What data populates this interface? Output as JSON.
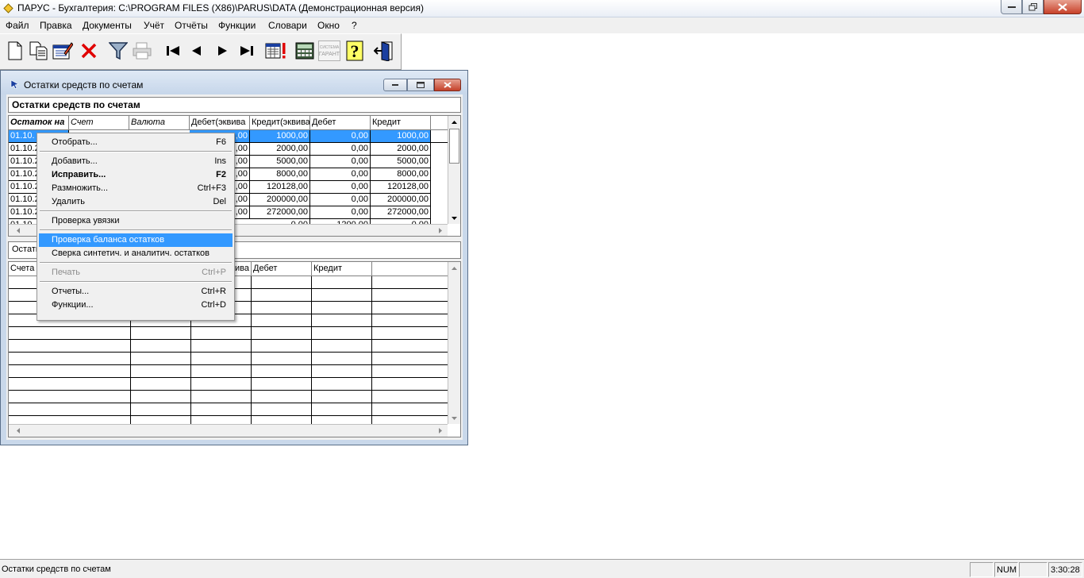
{
  "window": {
    "title": "ПАРУС - Бухгалтерия: C:\\PROGRAM FILES (X86)\\PARUS\\DATA (Демонстрационная версия)"
  },
  "menu": [
    "Файл",
    "Правка",
    "Документы",
    "Учёт",
    "Отчёты",
    "Функции",
    "Словари",
    "Окно",
    "?"
  ],
  "toolbar": {
    "buttons": [
      "new-doc-icon",
      "copy-doc-icon",
      "edit-doc-icon",
      "delete-icon",
      "filter-icon",
      "print-icon",
      "first-record-icon",
      "prev-record-icon",
      "next-record-icon",
      "last-record-icon",
      "calendar-alert-icon",
      "calculator-icon",
      "garant-icon",
      "help-icon",
      "exit-icon"
    ],
    "garant_text": [
      "СИСТЕМА",
      "ГАРАНТ"
    ],
    "help_glyph": "?"
  },
  "child": {
    "title": "Остатки средств по счетам",
    "section_title": "Остатки средств по счетам",
    "top_grid": {
      "headers": [
        "Остаток на",
        "Счет",
        "Валюта",
        "Дебет(эквива",
        "Кредит(эквива",
        "Дебет",
        "Кредит"
      ],
      "rows": [
        [
          "01.10.",
          "",
          "",
          ",00",
          "1000,00",
          "0,00",
          "1000,00"
        ],
        [
          "01.10.2",
          "",
          "",
          ",00",
          "2000,00",
          "0,00",
          "2000,00"
        ],
        [
          "01.10.2",
          "",
          "",
          ",00",
          "5000,00",
          "0,00",
          "5000,00"
        ],
        [
          "01.10.2",
          "",
          "",
          ",00",
          "8000,00",
          "0,00",
          "8000,00"
        ],
        [
          "01.10.2",
          "",
          "",
          ",00",
          "120128,00",
          "0,00",
          "120128,00"
        ],
        [
          "01.10.2",
          "",
          "",
          ",00",
          "200000,00",
          "0,00",
          "200000,00"
        ],
        [
          "01.10.2",
          "",
          "",
          ",00",
          "272000,00",
          "0,00",
          "272000,00"
        ]
      ],
      "partial_row": [
        "01.10.",
        "",
        "",
        "",
        "0,00",
        "1200,00",
        "0,00"
      ]
    },
    "tab_label": "Остатк",
    "bottom_grid": {
      "headers": [
        "Счета",
        "",
        "",
        "вива",
        "Дебет",
        "Кредит"
      ]
    }
  },
  "context_menu": [
    {
      "label": "Отобрать...",
      "shortcut": "F6"
    },
    {
      "sep": true
    },
    {
      "label": "Добавить...",
      "shortcut": "Ins"
    },
    {
      "label": "Исправить...",
      "shortcut": "F2",
      "bold": true
    },
    {
      "label": "Размножить...",
      "shortcut": "Ctrl+F3"
    },
    {
      "label": "Удалить",
      "shortcut": "Del"
    },
    {
      "sep": true
    },
    {
      "label": "Проверка увязки",
      "shortcut": ""
    },
    {
      "sep": true
    },
    {
      "label": "Проверка баланса остатков",
      "shortcut": "",
      "highlighted": true
    },
    {
      "label": "Сверка синтетич. и аналитич. остатков",
      "shortcut": ""
    },
    {
      "sep": true
    },
    {
      "label": "Печать",
      "shortcut": "Ctrl+P",
      "disabled": true
    },
    {
      "sep": true
    },
    {
      "label": "Отчеты...",
      "shortcut": "Ctrl+R"
    },
    {
      "label": "Функции...",
      "shortcut": "Ctrl+D"
    }
  ],
  "statusbar": {
    "message": "Остатки средств по счетам",
    "num": "NUM",
    "time": "3:30:28"
  },
  "colors": {
    "selection": "#3399ff",
    "close_button": "#c7412a"
  }
}
